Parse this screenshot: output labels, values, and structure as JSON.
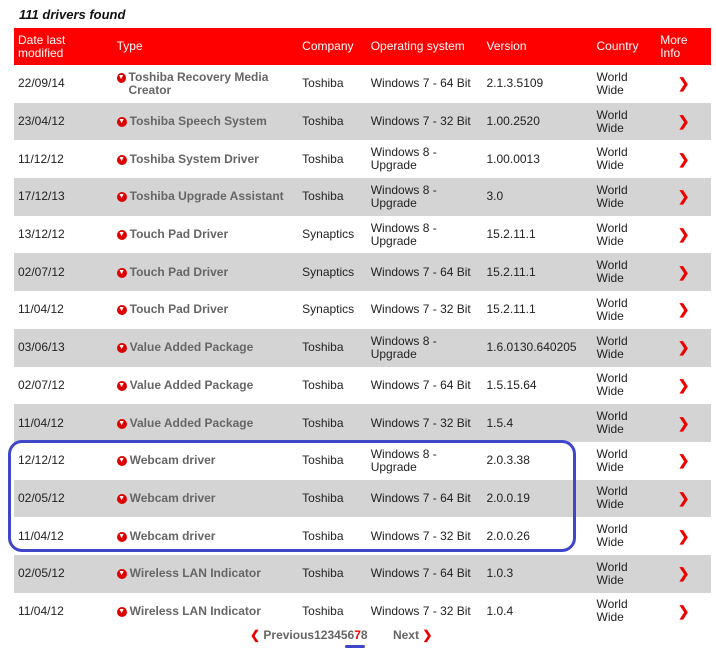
{
  "found": "111 drivers found",
  "headers": [
    "Date last modified",
    "Type",
    "Company",
    "Operating system",
    "Version",
    "Country",
    "More Info"
  ],
  "rows": [
    [
      "22/09/14",
      "Toshiba Recovery Media Creator",
      "Toshiba",
      "Windows 7 - 64 Bit",
      "2.1.3.5109",
      "World Wide"
    ],
    [
      "23/04/12",
      "Toshiba Speech System",
      "Toshiba",
      "Windows 7 - 32 Bit",
      "1.00.2520",
      "World Wide"
    ],
    [
      "11/12/12",
      "Toshiba System Driver",
      "Toshiba",
      "Windows 8 - Upgrade",
      "1.00.0013",
      "World Wide"
    ],
    [
      "17/12/13",
      "Toshiba Upgrade Assistant",
      "Toshiba",
      "Windows 8 - Upgrade",
      "3.0",
      "World Wide"
    ],
    [
      "13/12/12",
      "Touch Pad Driver",
      "Synaptics",
      "Windows 8 - Upgrade",
      "15.2.11.1",
      "World Wide"
    ],
    [
      "02/07/12",
      "Touch Pad Driver",
      "Synaptics",
      "Windows 7 - 64 Bit",
      "15.2.11.1",
      "World Wide"
    ],
    [
      "11/04/12",
      "Touch Pad Driver",
      "Synaptics",
      "Windows 7 - 32 Bit",
      "15.2.11.1",
      "World Wide"
    ],
    [
      "03/06/13",
      "Value Added Package",
      "Toshiba",
      "Windows 8 - Upgrade",
      "1.6.0130.640205",
      "World Wide"
    ],
    [
      "02/07/12",
      "Value Added Package",
      "Toshiba",
      "Windows 7 - 64 Bit",
      "1.5.15.64",
      "World Wide"
    ],
    [
      "11/04/12",
      "Value Added Package",
      "Toshiba",
      "Windows 7 - 32 Bit",
      "1.5.4",
      "World Wide"
    ],
    [
      "12/12/12",
      "Webcam driver",
      "Toshiba",
      "Windows 8 - Upgrade",
      "2.0.3.38",
      "World Wide"
    ],
    [
      "02/05/12",
      "Webcam driver",
      "Toshiba",
      "Windows 7 - 64 Bit",
      "2.0.0.19",
      "World Wide"
    ],
    [
      "11/04/12",
      "Webcam driver",
      "Toshiba",
      "Windows 7 - 32 Bit",
      "2.0.0.26",
      "World Wide"
    ],
    [
      "02/05/12",
      "Wireless LAN Indicator",
      "Toshiba",
      "Windows 7 - 64 Bit",
      "1.0.3",
      "World Wide"
    ],
    [
      "11/04/12",
      "Wireless LAN Indicator",
      "Toshiba",
      "Windows 7 - 32 Bit",
      "1.0.4",
      "World Wide"
    ]
  ],
  "pager": {
    "previous": "Previous",
    "pages": [
      "1",
      "2",
      "3",
      "4",
      "5",
      "6",
      "7",
      "8"
    ],
    "current": "7",
    "next": "Next"
  },
  "colors": {
    "accent": "#ff0000",
    "highlight": "#3f47c8"
  }
}
